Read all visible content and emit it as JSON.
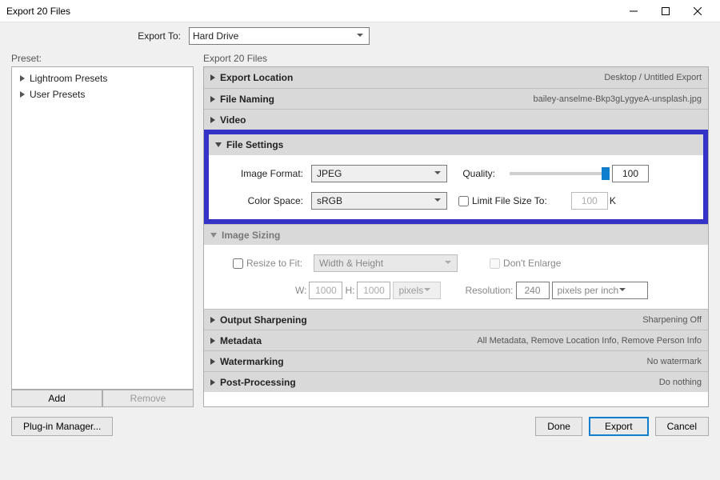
{
  "window": {
    "title": "Export 20 Files"
  },
  "exportTo": {
    "label": "Export To:",
    "value": "Hard Drive"
  },
  "preset": {
    "label": "Preset:",
    "items": [
      "Lightroom Presets",
      "User Presets"
    ],
    "addLabel": "Add",
    "removeLabel": "Remove"
  },
  "panelsHeader": "Export 20 Files",
  "sections": {
    "exportLocation": {
      "title": "Export Location",
      "summary": "Desktop / Untitled Export"
    },
    "fileNaming": {
      "title": "File Naming",
      "summary": "bailey-anselme-Bkp3gLygyeA-unsplash.jpg"
    },
    "video": {
      "title": "Video"
    },
    "fileSettings": {
      "title": "File Settings",
      "imageFormatLabel": "Image Format:",
      "imageFormat": "JPEG",
      "qualityLabel": "Quality:",
      "quality": "100",
      "colorSpaceLabel": "Color Space:",
      "colorSpace": "sRGB",
      "limitLabel": "Limit File Size To:",
      "limitValue": "100",
      "limitUnit": "K"
    },
    "imageSizing": {
      "title": "Image Sizing",
      "resizeLabel": "Resize to Fit:",
      "resizeMode": "Width & Height",
      "dontEnlarge": "Don't Enlarge",
      "wLabel": "W:",
      "wValue": "1000",
      "hLabel": "H:",
      "hValue": "1000",
      "unit": "pixels",
      "resLabel": "Resolution:",
      "resValue": "240",
      "resUnit": "pixels per inch"
    },
    "outputSharpening": {
      "title": "Output Sharpening",
      "summary": "Sharpening Off"
    },
    "metadata": {
      "title": "Metadata",
      "summary": "All Metadata, Remove Location Info, Remove Person Info"
    },
    "watermarking": {
      "title": "Watermarking",
      "summary": "No watermark"
    },
    "postProcessing": {
      "title": "Post-Processing",
      "summary": "Do nothing"
    }
  },
  "footer": {
    "plugin": "Plug-in Manager...",
    "done": "Done",
    "export": "Export",
    "cancel": "Cancel"
  }
}
